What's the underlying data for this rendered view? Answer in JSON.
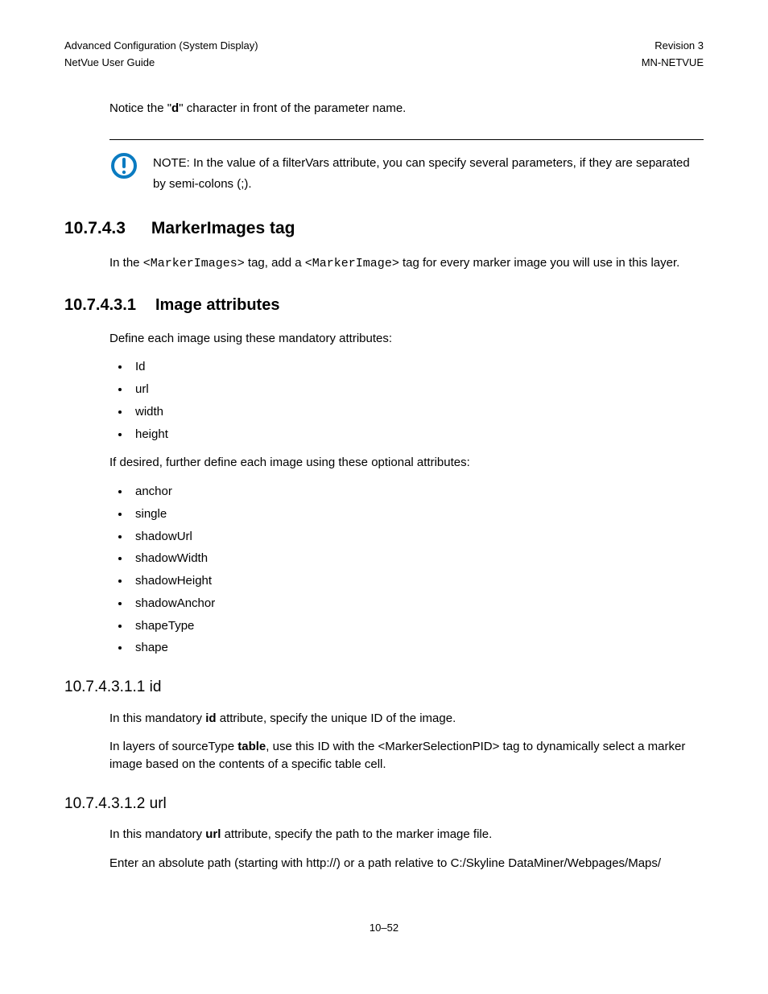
{
  "header": {
    "left1": "Advanced Configuration (System Display)",
    "right1": "Revision 3",
    "left2": "NetVue User Guide",
    "right2": "MN-NETVUE"
  },
  "notice": {
    "pre": "Notice the \"",
    "bold": "d",
    "post": "\" character in front of the parameter name."
  },
  "note": "NOTE:  In the value of a filterVars attribute, you can specify several parameters, if they are separated by semi-colons (;).",
  "s10743": {
    "num": "10.7.4.3",
    "title": "MarkerImages tag",
    "p_pre": "In the ",
    "tag1": "<MarkerImages>",
    "p_mid": " tag, add a ",
    "tag2": "<MarkerImage>",
    "p_post": " tag for every marker image you will use in this layer."
  },
  "s107431": {
    "num": "10.7.4.3.1",
    "title": "Image attributes",
    "intro": "Define each image using these mandatory attributes:",
    "mandatory": [
      "Id",
      "url",
      "width",
      "height"
    ],
    "optional_intro": "If desired, further define each image using these optional attributes:",
    "optional": [
      "anchor",
      "single",
      "shadowUrl",
      "shadowWidth",
      "shadowHeight",
      "shadowAnchor",
      "shapeType",
      "shape"
    ]
  },
  "s1074311": {
    "heading": "10.7.4.3.1.1 id",
    "p1_pre": "In this mandatory ",
    "p1_bold": "id",
    "p1_post": " attribute, specify the unique ID of the image.",
    "p2_pre": "In layers of sourceType ",
    "p2_bold": "table",
    "p2_post": ", use this ID with the <MarkerSelectionPID> tag to dynamically select a marker image based on the contents of a specific table cell."
  },
  "s1074312": {
    "heading": "10.7.4.3.1.2 url",
    "p1_pre": "In this mandatory ",
    "p1_bold": "url",
    "p1_post": " attribute, specify the path to the marker image file.",
    "p2": "Enter an absolute path (starting with http://) or a path relative to C:/Skyline DataMiner/Webpages/Maps/"
  },
  "footer": "10–52"
}
